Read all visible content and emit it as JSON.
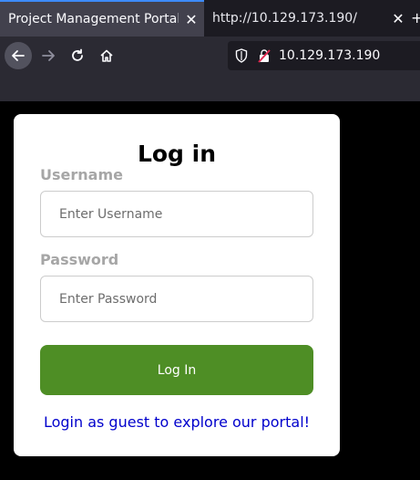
{
  "browser": {
    "tabs": [
      {
        "title": "Project Management Portal",
        "active": true
      },
      {
        "title": "http://10.129.173.190/",
        "active": false
      }
    ],
    "tab_close_glyph": "✕",
    "new_tab_glyph": "+",
    "url": "10.129.173.190",
    "accent_color": "#3d8bf8"
  },
  "login": {
    "heading": "Log in",
    "username_label": "Username",
    "username_placeholder": "Enter Username",
    "password_label": "Password",
    "password_placeholder": "Enter Password",
    "submit_label": "Log In",
    "guest_link": "Login as guest to explore our portal!",
    "button_color": "#4e8e25",
    "link_color": "#0000cc"
  }
}
